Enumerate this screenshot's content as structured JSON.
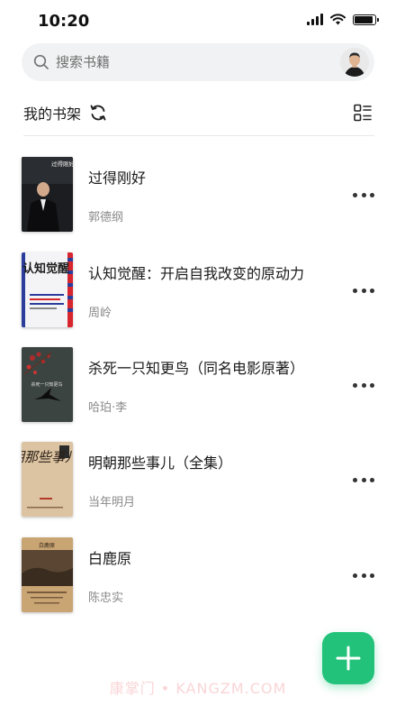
{
  "status_bar": {
    "time": "10:20"
  },
  "search": {
    "placeholder": "搜索书籍"
  },
  "shelf": {
    "title": "我的书架"
  },
  "books": [
    {
      "title": "过得刚好",
      "author": "郭德纲"
    },
    {
      "title": "认知觉醒：开启自我改变的原动力",
      "author": "周岭"
    },
    {
      "title": "杀死一只知更鸟（同名电影原著）",
      "author": "哈珀·李"
    },
    {
      "title": "明朝那些事儿（全集）",
      "author": "当年明月"
    },
    {
      "title": "白鹿原",
      "author": "陈忠实"
    }
  ],
  "cover_texts": {
    "book0": "过得刚好",
    "book1": "认知觉醒",
    "book2": "杀死一只知更鸟",
    "book3": "明朝那些事儿",
    "book4": "白鹿原"
  },
  "watermark": "康掌门 • KANGZM.COM",
  "colors": {
    "accent": "#22c27a",
    "text": "#1a1a1a",
    "secondary": "#8a8a8a"
  },
  "icons": [
    "search-icon",
    "refresh-icon",
    "list-view-icon",
    "more-icon",
    "plus-icon"
  ]
}
